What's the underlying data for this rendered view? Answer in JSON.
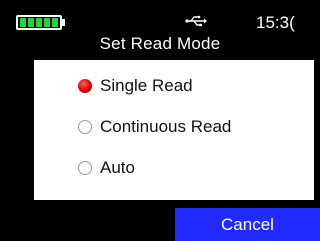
{
  "status_bar": {
    "battery_icon": "battery-full-icon",
    "battery_level": 1.0,
    "battery_color": "#22d43a",
    "usb_icon": "usb-icon",
    "time": "15:3("
  },
  "title": "Set Read Mode",
  "read_mode": {
    "selected": "Single Read",
    "options": [
      {
        "label": "Single Read",
        "checked": true
      },
      {
        "label": "Continuous Read",
        "checked": false
      },
      {
        "label": "Auto",
        "checked": false
      }
    ],
    "selected_color": "#e00000"
  },
  "actions": {
    "cancel_label": "Cancel",
    "cancel_color": "#1f2bff"
  }
}
